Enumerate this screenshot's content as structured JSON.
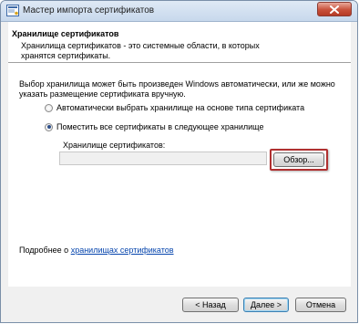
{
  "window": {
    "title": "Мастер импорта сертификатов"
  },
  "header": {
    "title": "Хранилище сертификатов",
    "description": "Хранилища сертификатов - это системные области, в которых хранятся сертификаты."
  },
  "body": {
    "description": "Выбор хранилища может быть произведен Windows автоматически, или же можно указать размещение сертификата вручную."
  },
  "options": [
    {
      "label": "Автоматически выбрать хранилище на основе типа сертификата",
      "selected": false
    },
    {
      "label": "Поместить все сертификаты в следующее хранилище",
      "selected": true
    }
  ],
  "store": {
    "label": "Хранилище сертификатов:",
    "value": "",
    "browse_label": "Обзор..."
  },
  "learn_more": {
    "prefix": "Подробнее о ",
    "link_text": "хранилищах сертификатов"
  },
  "buttons": {
    "back": "< Назад",
    "next": "Далее >",
    "cancel": "Отмена"
  },
  "colors": {
    "highlight": "#b03030",
    "link": "#0645ad"
  }
}
